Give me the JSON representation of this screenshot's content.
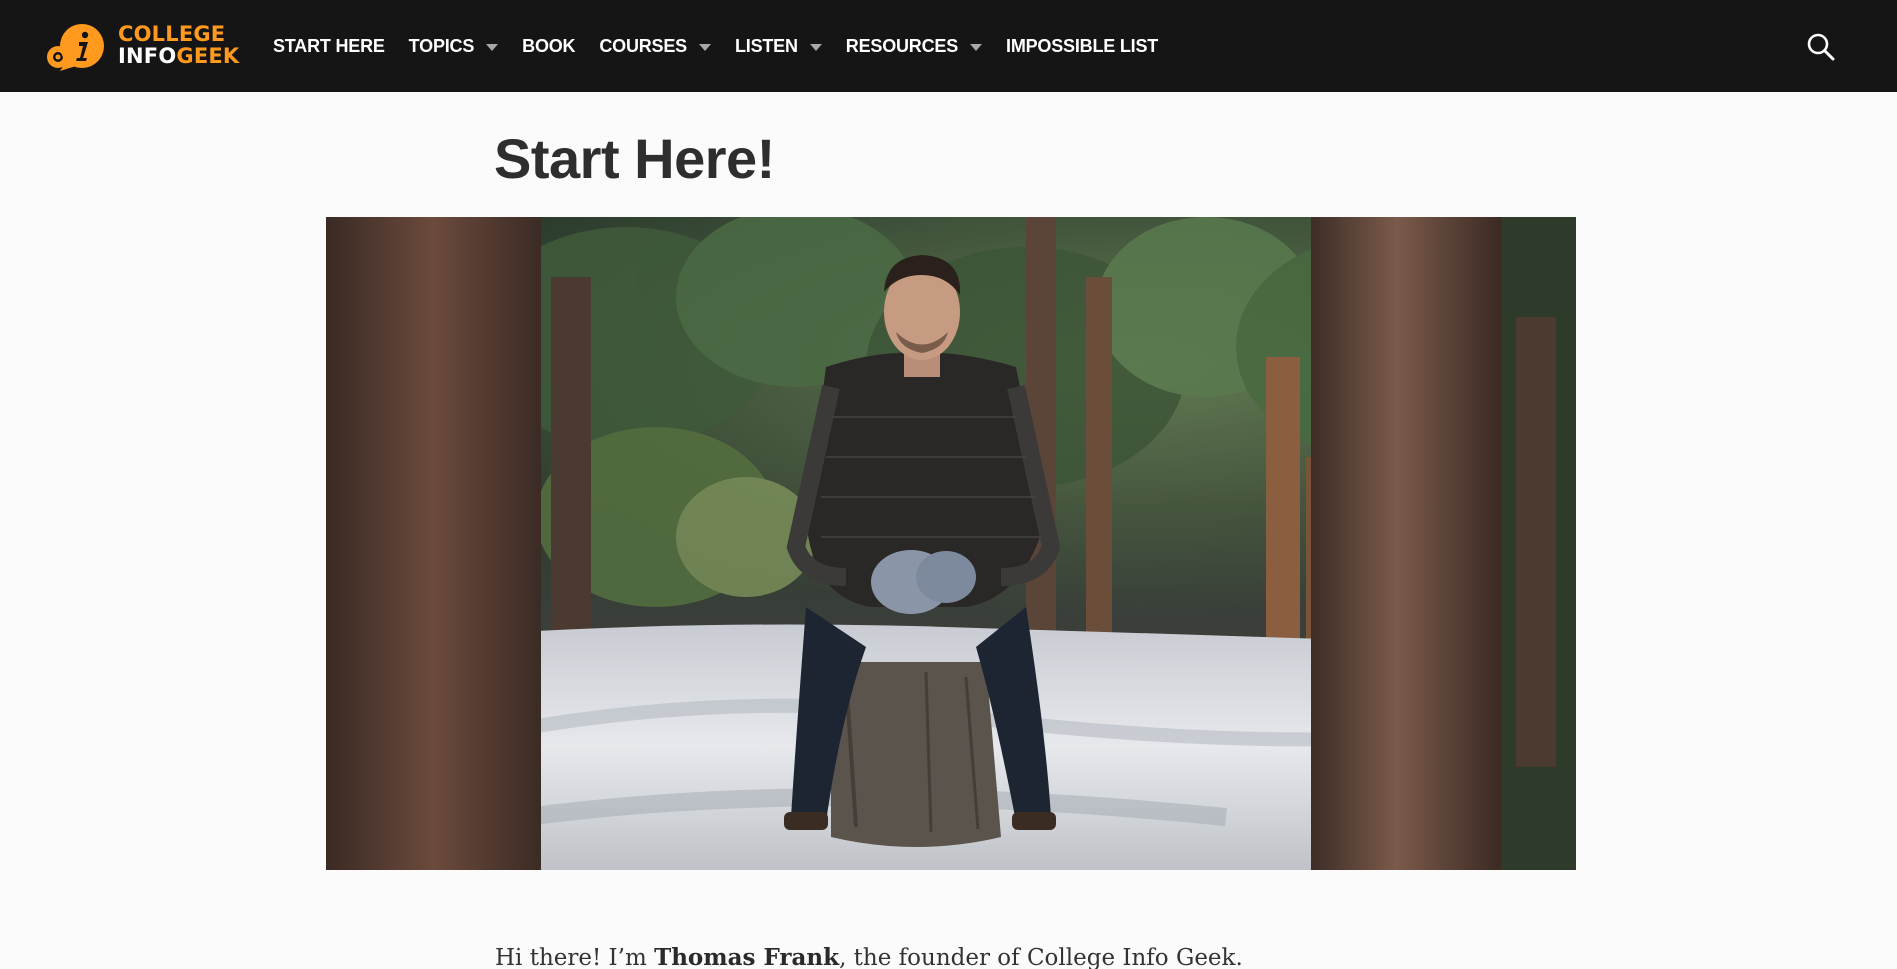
{
  "header": {
    "logo": {
      "line1": "COLLEGE",
      "line2_part1": "INFO",
      "line2_part2": "GEEK",
      "icon": "info-speech-bubble-icon",
      "brand_color": "#ff9a1f"
    },
    "nav": [
      {
        "label": "START HERE",
        "has_dropdown": false
      },
      {
        "label": "TOPICS",
        "has_dropdown": true
      },
      {
        "label": "BOOK",
        "has_dropdown": false
      },
      {
        "label": "COURSES",
        "has_dropdown": true
      },
      {
        "label": "LISTEN",
        "has_dropdown": true
      },
      {
        "label": "RESOURCES",
        "has_dropdown": true
      },
      {
        "label": "IMPOSSIBLE LIST",
        "has_dropdown": false
      }
    ],
    "search_icon": "search-icon",
    "background": "#151515"
  },
  "main": {
    "title": "Start Here!",
    "hero_image": "photo-man-sitting-on-stump-in-snowy-forest",
    "intro": {
      "before": "Hi there! I’m ",
      "name": "Thomas Frank",
      "after": ", the founder of College Info Geek."
    }
  }
}
